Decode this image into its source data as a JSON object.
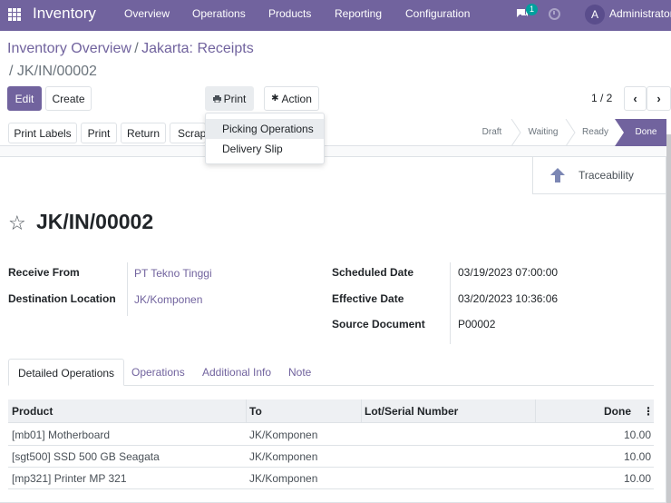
{
  "navbar": {
    "brand": "Inventory",
    "menu": [
      "Overview",
      "Operations",
      "Products",
      "Reporting",
      "Configuration"
    ],
    "chat_badge": "1",
    "avatar_letter": "A",
    "user": "Administrator"
  },
  "breadcrumb": {
    "parts": [
      "Inventory Overview",
      "Jakarta: Receipts"
    ],
    "separator": "/",
    "current": "/ JK/IN/00002"
  },
  "actions": {
    "edit": "Edit",
    "create": "Create",
    "print": "Print",
    "action": "Action"
  },
  "pager": {
    "value": "1 / 2",
    "prev": "‹",
    "next": "›"
  },
  "print_menu": {
    "items": [
      "Picking Operations",
      "Delivery Slip"
    ]
  },
  "statusbar": {
    "buttons": [
      "Print Labels",
      "Print",
      "Return",
      "Scrap"
    ],
    "stages": [
      "Draft",
      "Waiting",
      "Ready",
      "Done"
    ],
    "current_stage": "Done"
  },
  "smart_button": {
    "label": "Traceability"
  },
  "record": {
    "title": "JK/IN/00002",
    "left_fields": [
      {
        "label": "Receive From",
        "value": "PT Tekno Tinggi"
      },
      {
        "label": "Destination Location",
        "value": "JK/Komponen"
      }
    ],
    "right_fields": [
      {
        "label": "Scheduled Date",
        "value": "03/19/2023 07:00:00"
      },
      {
        "label": "Effective Date",
        "value": "03/20/2023 10:36:06"
      },
      {
        "label": "Source Document",
        "value": "P00002"
      }
    ]
  },
  "tabs": [
    "Detailed Operations",
    "Operations",
    "Additional Info",
    "Note"
  ],
  "table": {
    "headers": [
      "Product",
      "To",
      "Lot/Serial Number",
      "Done"
    ],
    "rows": [
      {
        "product": "[mb01] Motherboard",
        "to": "JK/Komponen",
        "lot": "",
        "done": "10.00"
      },
      {
        "product": "[sgt500] SSD 500 GB Seagata",
        "to": "JK/Komponen",
        "lot": "",
        "done": "10.00"
      },
      {
        "product": "[mp321] Printer MP 321",
        "to": "JK/Komponen",
        "lot": "",
        "done": "10.00"
      }
    ]
  },
  "colors": {
    "brand": "#71639e",
    "badge": "#00a09d"
  }
}
